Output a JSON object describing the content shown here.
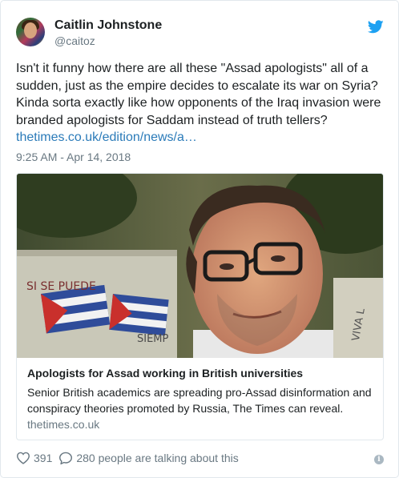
{
  "author": {
    "name": "Caitlin Johnstone",
    "handle": "@caitoz"
  },
  "tweet": {
    "text": "Isn't it funny how there are all these \"Assad apologists\" all of a sudden, just as the empire decides to escalate its war on Syria? Kinda sorta exactly like how opponents of the Iraq invasion were branded apologists for Saddam instead of truth tellers?",
    "link": "thetimes.co.uk/edition/news/a…",
    "timestamp": "9:25 AM - Apr 14, 2018"
  },
  "card": {
    "title": "Apologists for Assad working in British universities",
    "description": "Senior British academics are spreading pro-Assad disinformation and conspiracy theories promoted by Russia, The Times can reveal.",
    "domain": "thetimes.co.uk",
    "image_text": [
      "SI SE PUEDE",
      "SIEMP",
      "VIVA L"
    ]
  },
  "actions": {
    "likes": "391",
    "talking": "280 people are talking about this"
  },
  "colors": {
    "link": "#2b7bb9",
    "muted": "#697882",
    "twitter_blue": "#1da1f2"
  },
  "icons": [
    "twitter-bird-icon",
    "heart-icon",
    "comment-bubble-icon",
    "info-icon"
  ]
}
